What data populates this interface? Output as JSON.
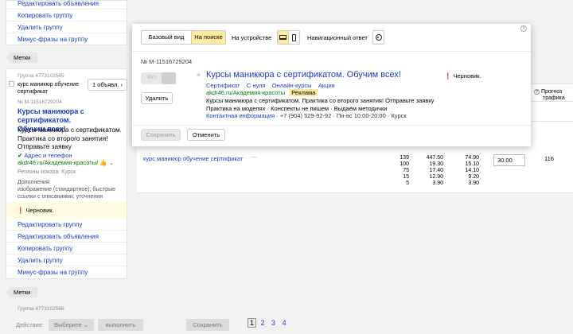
{
  "left_top_menu": [
    "Редактировать объявления",
    "Копировать группу",
    "Удалить группу",
    "Минус-фразы на группу"
  ],
  "tags_label": "Метки",
  "group_card": {
    "group_number": "Группа 4773102565",
    "group_name": "курс маникюр обучение сертификат",
    "ads_count_button": "1 объявл.",
    "ad_number": "№ M-11516729204",
    "ad_title_line1": "Курсы маникюра с сертификатом.",
    "ad_title_line2": "Обучим всех!",
    "ad_text_line1": "Курсы маникюра с сертификатом.",
    "ad_text_line2": "Практика со второго занятия!",
    "ad_text_line3": "Отправьте заявку",
    "address_link": "Адрес и телефон",
    "display_url": "akdr46.ru/Академия-красоты",
    "display_url_suffix": "/ ",
    "regions": "Регионы показа: Курск",
    "extras_title": "Дополнения:",
    "extras_line1": "изображение (стандартное), быстрые",
    "extras_line2": "ссылки с описаниями, уточнения",
    "status_text": "Черновик.",
    "menu": [
      "Редактировать группу",
      "Редактировать объявления",
      "Копировать группу",
      "Удалить группу",
      "Минус-фразы на группу"
    ]
  },
  "tags_label_2": "Метки",
  "next_group_number": "Группа 4773102566",
  "table": {
    "forecast_header_line1": "Прогноз",
    "forecast_header_line2": "трафика",
    "keyword": "курс маникюр обучение сертификат",
    "keyword_menu": "···",
    "traffic_col1": [
      "139",
      "100",
      "75",
      "15",
      "5"
    ],
    "traffic_col2": [
      "447.50",
      "19.30",
      "17.40",
      "12.90",
      "3.90"
    ],
    "traffic_col3": [
      "74.90",
      "15.10",
      "14.10",
      "9.20",
      "3.90"
    ],
    "bid_value": "30.00",
    "forecast_value": "116"
  },
  "modal": {
    "view_tabs": [
      "Базовый вид",
      "На поиске"
    ],
    "device_label": "На устройстве",
    "nav_answer_label": "Навигационный ответ",
    "ad_number": "№ M-11516729204",
    "toggle_label": "Вкл",
    "delete_button": "Удалить",
    "preview_title": "Курсы маникюра с сертификатом. Обучим всех!",
    "sitelinks": [
      "Сертификат",
      "С нуля",
      "Онлайн-курсы",
      "Акция"
    ],
    "display_url": "akdr46.ru/Академия-красоты",
    "ad_badge": "Реклама",
    "preview_text": "Курсы маникюра с сертификатом. Практика со второго занятия! Отправьте заявку",
    "callouts": [
      "Практика на моделях",
      "Конспекты не пишем",
      "Выдаём методички"
    ],
    "contact_link": "Контактная информация",
    "phone": "+7 (904) 529-92-92",
    "hours": "Пн-вс 10:00-20:00",
    "city": "Курск",
    "status_text": "Черновик.",
    "save_button": "Сохранить",
    "cancel_button": "Отменить"
  },
  "bottom_bar": {
    "action_label": "Действие:",
    "select_label": "Выберите",
    "run_button": "выполнить",
    "save_button": "Сохранить",
    "pages": [
      "1",
      "2",
      "3",
      "4"
    ]
  },
  "colors": {
    "link": "#1a3dc1",
    "url_green": "#007700",
    "status_bg": "#fffbe0",
    "active_tab": "#ffeba0",
    "badge_bg": "#ffeba0"
  }
}
